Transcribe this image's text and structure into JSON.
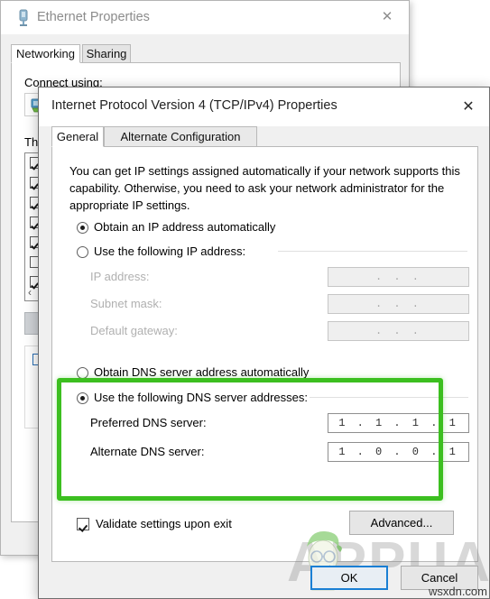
{
  "background_window": {
    "title": "Ethernet Properties",
    "title_icon": "ethernet-connector-icon",
    "close_label": "✕",
    "tabs": [
      {
        "label": "Networking",
        "active": true
      },
      {
        "label": "Sharing",
        "active": false
      }
    ],
    "connect_using_label": "Connect using:",
    "this_connection_label": "Th",
    "list_scroll_arrow": "‹",
    "list_items": [
      {
        "checked": true
      },
      {
        "checked": true
      },
      {
        "checked": true
      },
      {
        "checked": true
      },
      {
        "checked": true
      },
      {
        "checked": false
      },
      {
        "checked": true
      }
    ]
  },
  "dialog": {
    "title": "Internet Protocol Version 4 (TCP/IPv4) Properties",
    "close_label": "✕",
    "close_icon": "close-icon",
    "tabs": [
      {
        "label": "General",
        "active": true
      },
      {
        "label": "Alternate Configuration",
        "active": false
      }
    ],
    "description": "You can get IP settings assigned automatically if your network supports this capability. Otherwise, you need to ask your network administrator for the appropriate IP settings.",
    "ip_section": {
      "auto_radio_label": "Obtain an IP address automatically",
      "auto_radio_selected": true,
      "manual_radio_label": "Use the following IP address:",
      "manual_radio_selected": false,
      "fields": [
        {
          "label": "IP address:",
          "value": ".   .   .",
          "enabled": false
        },
        {
          "label": "Subnet mask:",
          "value": ".   .   .",
          "enabled": false
        },
        {
          "label": "Default gateway:",
          "value": ".   .   .",
          "enabled": false
        }
      ]
    },
    "dns_section": {
      "auto_radio_label": "Obtain DNS server address automatically",
      "auto_radio_selected": false,
      "manual_radio_label": "Use the following DNS server addresses:",
      "manual_radio_selected": true,
      "fields": [
        {
          "label": "Preferred DNS server:",
          "value": "1 . 1 . 1 . 1",
          "enabled": true
        },
        {
          "label": "Alternate DNS server:",
          "value": "1 . 0 . 0 . 1",
          "enabled": true
        }
      ],
      "highlight_color": "#3cbf20"
    },
    "validate_checkbox": {
      "label": "Validate settings upon exit",
      "checked": true
    },
    "buttons": {
      "advanced": "Advanced...",
      "ok": "OK",
      "cancel": "Cancel",
      "ok_focus_color": "#1a7fd4"
    }
  },
  "watermarks": {
    "brand": "APPUALS",
    "brand_mascot_icon": "appuals-mascot-icon",
    "site": "wsxdn.com"
  }
}
